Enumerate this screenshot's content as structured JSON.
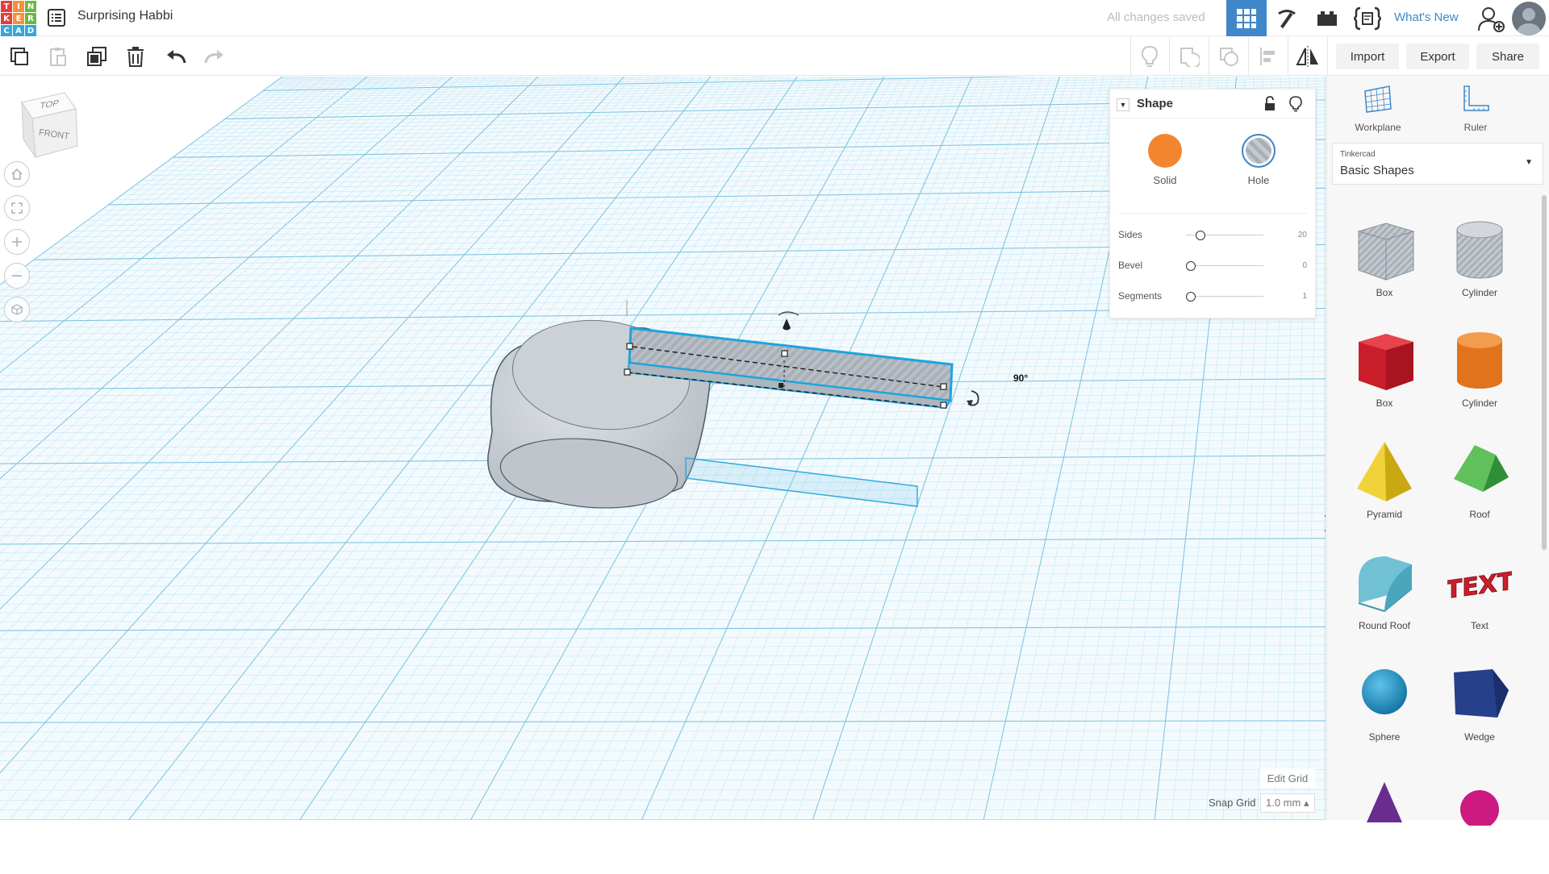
{
  "app": {
    "logo_letters": [
      "T",
      "I",
      "N",
      "K",
      "E",
      "R",
      "C",
      "A",
      "D"
    ],
    "logo_colors": [
      "#e2403a",
      "#f4913b",
      "#6bb841",
      "#e2403a",
      "#f4913b",
      "#6bb841",
      "#35a7d8",
      "#35a7d8",
      "#35a7d8"
    ],
    "accent_color": "#3f87c9"
  },
  "header": {
    "project_title": "Surprising Habbi",
    "save_status": "All changes saved",
    "whats_new": "What's New",
    "buttons": [
      {
        "icon": "grid-view-icon",
        "active": true
      },
      {
        "icon": "pickaxe-icon",
        "active": false
      },
      {
        "icon": "bricks-icon",
        "active": false
      },
      {
        "icon": "codeblocks-icon",
        "active": false
      }
    ]
  },
  "toolbar": {
    "left_tools": [
      "copy-icon",
      "paste-icon",
      "duplicate-icon",
      "delete-icon",
      "undo-icon",
      "redo-icon"
    ],
    "right_tools": [
      "show-all-icon",
      "group-icon",
      "ungroup-icon",
      "align-icon",
      "mirror-icon"
    ],
    "import_label": "Import",
    "export_label": "Export",
    "share_label": "Share"
  },
  "viewcube": {
    "top_label": "TOP",
    "front_label": "FRONT"
  },
  "workspace": {
    "rotation_angle": "90°",
    "edit_grid_label": "Edit Grid",
    "snap_grid_label": "Snap Grid",
    "snap_grid_value": "1.0 mm ▴"
  },
  "inspector": {
    "title": "Shape",
    "solid_label": "Solid",
    "hole_label": "Hole",
    "solid_color": "#f4852f",
    "properties": [
      {
        "name": "Sides",
        "value": "20",
        "fraction": 0.13
      },
      {
        "name": "Bevel",
        "value": "0",
        "fraction": 0.0
      },
      {
        "name": "Segments",
        "value": "1",
        "fraction": 0.0
      }
    ]
  },
  "sidebar": {
    "workplane_label": "Workplane",
    "ruler_label": "Ruler",
    "library_source": "Tinkercad",
    "library_name": "Basic Shapes",
    "shapes": [
      {
        "label": "Box",
        "icon": "box-hole-icon"
      },
      {
        "label": "Cylinder",
        "icon": "cylinder-hole-icon"
      },
      {
        "label": "Box",
        "icon": "box-icon"
      },
      {
        "label": "Cylinder",
        "icon": "cylinder-icon"
      },
      {
        "label": "Pyramid",
        "icon": "pyramid-icon"
      },
      {
        "label": "Roof",
        "icon": "roof-icon"
      },
      {
        "label": "Round Roof",
        "icon": "round-roof-icon"
      },
      {
        "label": "Text",
        "icon": "text-icon"
      },
      {
        "label": "Sphere",
        "icon": "sphere-icon"
      },
      {
        "label": "Wedge",
        "icon": "wedge-icon"
      }
    ]
  }
}
